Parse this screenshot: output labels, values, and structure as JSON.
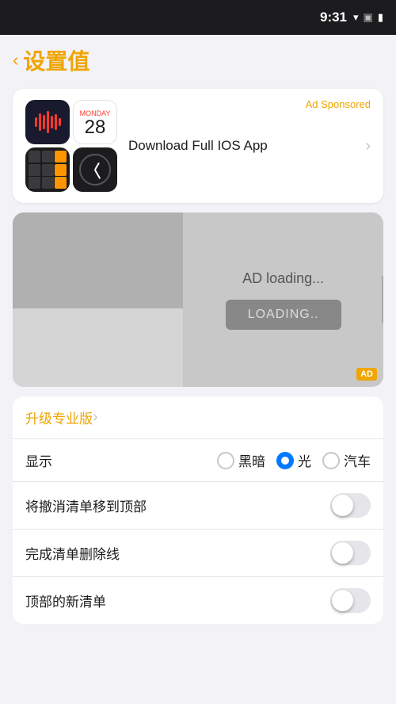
{
  "statusBar": {
    "time": "9:31",
    "wifiIcon": "▼",
    "signalIcon": "▣",
    "batteryIcon": "🔋"
  },
  "header": {
    "backLabel": "设置值",
    "backChevron": "‹"
  },
  "adCard": {
    "sponsoredLabel": "Ad Sponsored",
    "downloadLabel": "Download Full IOS App",
    "calendar": {
      "dayName": "Monday",
      "date": "28"
    }
  },
  "adLoading": {
    "loadingText": "AD loading...",
    "loadingBtn": "LOADING..",
    "adBadge": "AD"
  },
  "settings": {
    "upgradeLabel": "升级专业版",
    "displayLabel": "显示",
    "displayOptions": [
      {
        "label": "黑暗",
        "selected": false
      },
      {
        "label": "光",
        "selected": true
      },
      {
        "label": "汽车",
        "selected": false
      }
    ],
    "row1Label": "将撤消清单移到顶部",
    "row2Label": "完成清单删除线",
    "row3Label": "顶部的新清单"
  }
}
